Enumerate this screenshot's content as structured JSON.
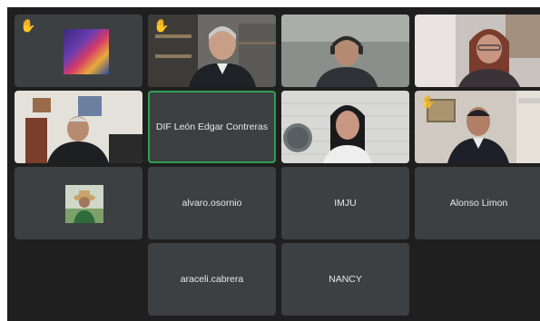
{
  "tiles": [
    {
      "type": "image",
      "label": "",
      "hand": true
    },
    {
      "type": "video",
      "label": "",
      "hand": true
    },
    {
      "type": "video",
      "label": ""
    },
    {
      "type": "video",
      "label": ""
    },
    {
      "type": "video",
      "label": ""
    },
    {
      "type": "name",
      "label": "DIF León Edgar Contreras",
      "speaking": true
    },
    {
      "type": "video",
      "label": ""
    },
    {
      "type": "video",
      "label": "",
      "hand": true
    },
    {
      "type": "image",
      "label": ""
    },
    {
      "type": "name",
      "label": "alvaro.osornio"
    },
    {
      "type": "name",
      "label": "IMJU"
    },
    {
      "type": "name",
      "label": "Alonso Limon"
    },
    {
      "type": "name",
      "label": "araceli.cabrera"
    },
    {
      "type": "name",
      "label": "NANCY"
    }
  ],
  "icons": {
    "raised_hand": "raised-hand-icon"
  },
  "colors": {
    "background": "#1f1f1f",
    "tile": "#3c4043",
    "speaking_border": "#2e9e4f",
    "hand": "#fdd663"
  }
}
